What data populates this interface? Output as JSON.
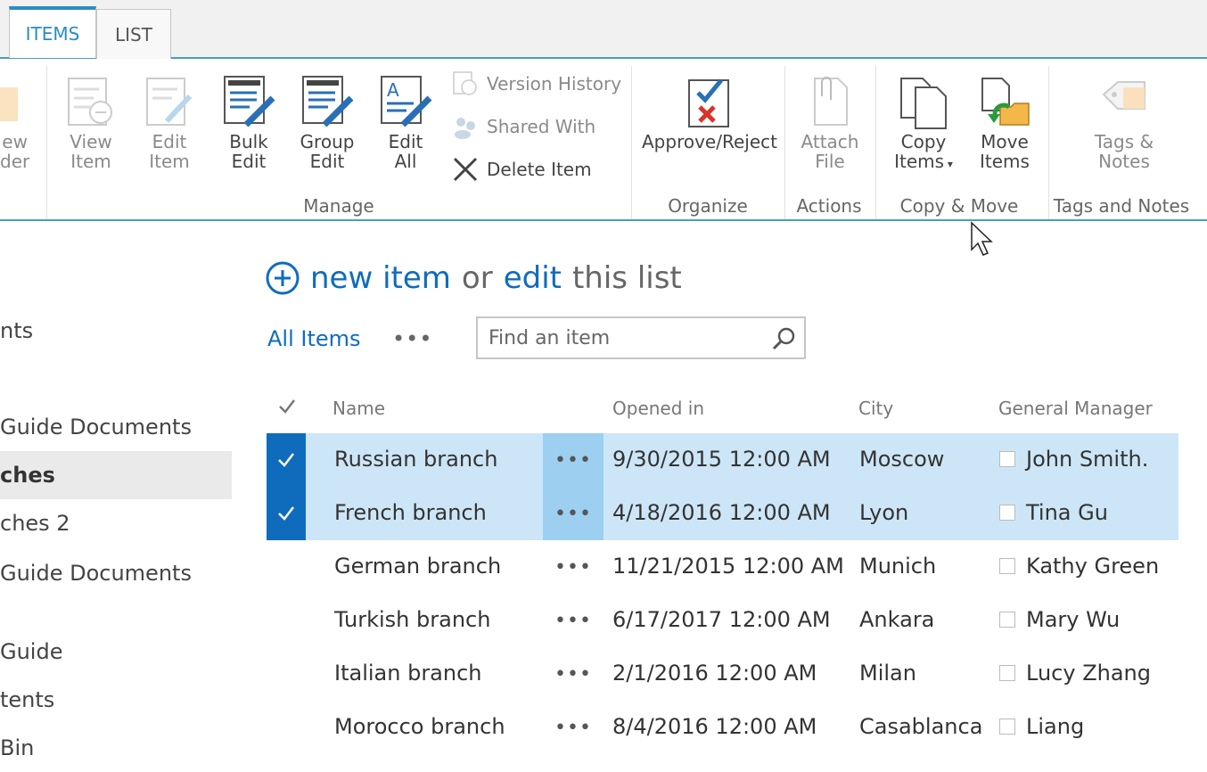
{
  "tabs": [
    {
      "label": "ITEMS",
      "active": true
    },
    {
      "label": "LIST",
      "active": false
    }
  ],
  "ribbon": {
    "cut_left_label": "ew\nder",
    "manage": {
      "group_label": "Manage",
      "view_item": "View\nItem",
      "edit_item": "Edit\nItem",
      "bulk_edit": "Bulk\nEdit",
      "group_edit": "Group\nEdit",
      "edit_all": "Edit\nAll",
      "version_history": "Version History",
      "shared_with": "Shared With",
      "delete_item": "Delete Item"
    },
    "organize": {
      "group_label": "Organize",
      "approve_reject": "Approve/Reject"
    },
    "actions": {
      "group_label": "Actions",
      "attach_file": "Attach\nFile"
    },
    "copy_move": {
      "group_label": "Copy & Move",
      "copy_items": "Copy\nItems",
      "move_items": "Move\nItems"
    },
    "tags_notes": {
      "group_label": "Tags and Notes",
      "tags_notes": "Tags &\nNotes"
    }
  },
  "nav": {
    "items": [
      {
        "label": "nts",
        "selected": false
      },
      {
        "label": "Guide Documents",
        "selected": false
      },
      {
        "label": "ches",
        "selected": true
      },
      {
        "label": "ches 2",
        "selected": false
      },
      {
        "label": "Guide Documents",
        "selected": false
      },
      {
        "label": "Guide",
        "selected": false
      },
      {
        "label": "tents",
        "selected": false
      },
      {
        "label": "Bin",
        "selected": false
      }
    ]
  },
  "main": {
    "new_item": "new item",
    "or": "or",
    "edit": "edit",
    "this_list": "this list",
    "view_all_items": "All Items",
    "more": "•••",
    "search_placeholder": "Find an item"
  },
  "table": {
    "columns": {
      "name": "Name",
      "opened_in": "Opened in",
      "city": "City",
      "general_manager": "General Manager"
    },
    "rows": [
      {
        "name": "Russian branch",
        "opened_in": "9/30/2015 12:00 AM",
        "city": "Moscow",
        "gm": "John Smith.",
        "selected": true
      },
      {
        "name": "French branch",
        "opened_in": "4/18/2016 12:00 AM",
        "city": "Lyon",
        "gm": "Tina Gu",
        "selected": true
      },
      {
        "name": "German branch",
        "opened_in": "11/21/2015 12:00 AM",
        "city": "Munich",
        "gm": "Kathy Green",
        "selected": false
      },
      {
        "name": "Turkish branch",
        "opened_in": "6/17/2017 12:00 AM",
        "city": "Ankara",
        "gm": "Mary Wu",
        "selected": false
      },
      {
        "name": "Italian branch",
        "opened_in": "2/1/2016 12:00 AM",
        "city": "Milan",
        "gm": "Lucy Zhang",
        "selected": false
      },
      {
        "name": "Morocco branch",
        "opened_in": "8/4/2016 12:00 AM",
        "city": "Casablanca",
        "gm": "Liang",
        "selected": false
      }
    ],
    "row_more": "•••"
  },
  "colors": {
    "accent": "#0f6cbd",
    "selected_row": "#cde6f7",
    "tab_accent": "#2a8dc4"
  }
}
